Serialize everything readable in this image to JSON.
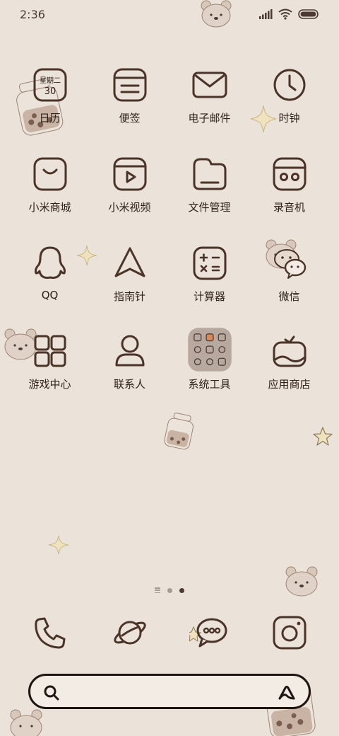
{
  "status_bar": {
    "time": "2:36"
  },
  "apps": [
    {
      "label": "日历",
      "icon": "calendar-icon",
      "calendar_weekday": "星期二",
      "calendar_day": "30"
    },
    {
      "label": "便签",
      "icon": "notes-icon"
    },
    {
      "label": "电子邮件",
      "icon": "mail-icon"
    },
    {
      "label": "时钟",
      "icon": "clock-icon"
    },
    {
      "label": "小米商城",
      "icon": "shopping-bag-icon"
    },
    {
      "label": "小米视频",
      "icon": "video-play-icon"
    },
    {
      "label": "文件管理",
      "icon": "folder-icon"
    },
    {
      "label": "录音机",
      "icon": "recorder-icon"
    },
    {
      "label": "QQ",
      "icon": "penguin-icon"
    },
    {
      "label": "指南针",
      "icon": "compass-arrow-icon"
    },
    {
      "label": "计算器",
      "icon": "calculator-icon"
    },
    {
      "label": "微信",
      "icon": "wechat-icon"
    },
    {
      "label": "游戏中心",
      "icon": "grid-squares-icon"
    },
    {
      "label": "联系人",
      "icon": "person-icon"
    },
    {
      "label": "系统工具",
      "icon": "folder-tools-icon"
    },
    {
      "label": "应用商店",
      "icon": "app-store-basket-icon"
    }
  ],
  "page_indicator": {
    "pages": 3,
    "active_index": 2
  },
  "dock": [
    {
      "icon": "phone-icon"
    },
    {
      "icon": "planet-browser-icon"
    },
    {
      "icon": "message-bubble-icon"
    },
    {
      "icon": "camera-icon"
    }
  ],
  "search_bar": {
    "left_icon": "search-icon",
    "right_icon": "assistant-a-icon"
  },
  "colors": {
    "background": "#ebe2d9",
    "icon_stroke": "#4a3328",
    "text": "#2e211b"
  }
}
